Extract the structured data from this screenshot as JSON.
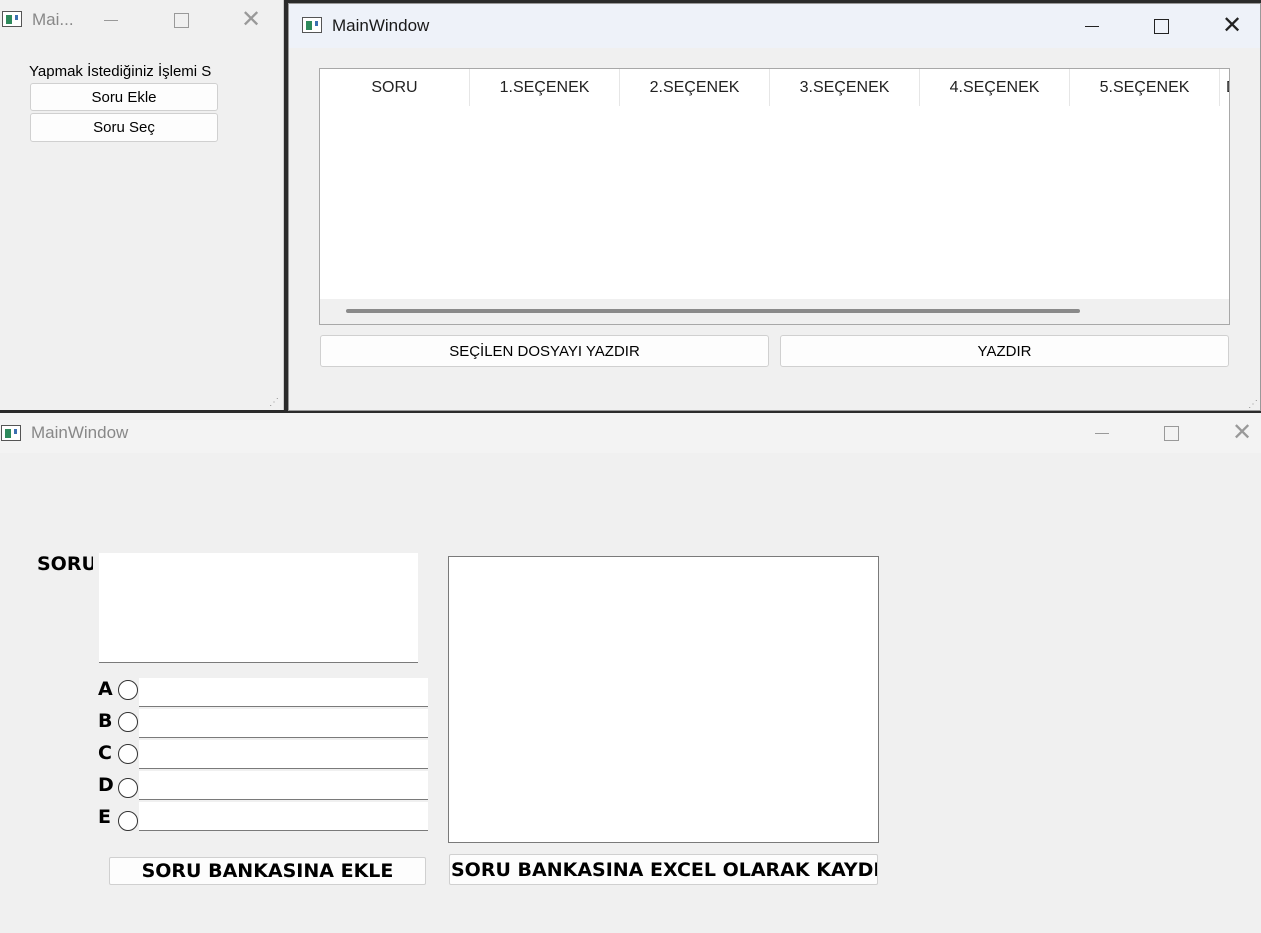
{
  "window_small": {
    "title": "Mai...",
    "prompt": "Yapmak İstediğiniz İşlemi S",
    "add_button": "Soru Ekle",
    "select_button": "Soru Seç"
  },
  "window_table": {
    "title": "MainWindow",
    "columns": [
      "SORU",
      "1.SEÇENEK",
      "2.SEÇENEK",
      "3.SEÇENEK",
      "4.SEÇENEK",
      "5.SEÇENEK",
      "D"
    ],
    "print_selected_button": "SEÇİLEN DOSYAYI YAZDIR",
    "print_button": "YAZDIR"
  },
  "window_editor": {
    "title": "MainWindow",
    "question_label": "SORU",
    "option_labels": [
      "A",
      "B",
      "C",
      "D",
      "E"
    ],
    "add_to_bank_button": "SORU BANKASINA EKLE",
    "save_excel_button": "SORU BANKASINA EXCEL OLARAK KAYDET"
  }
}
